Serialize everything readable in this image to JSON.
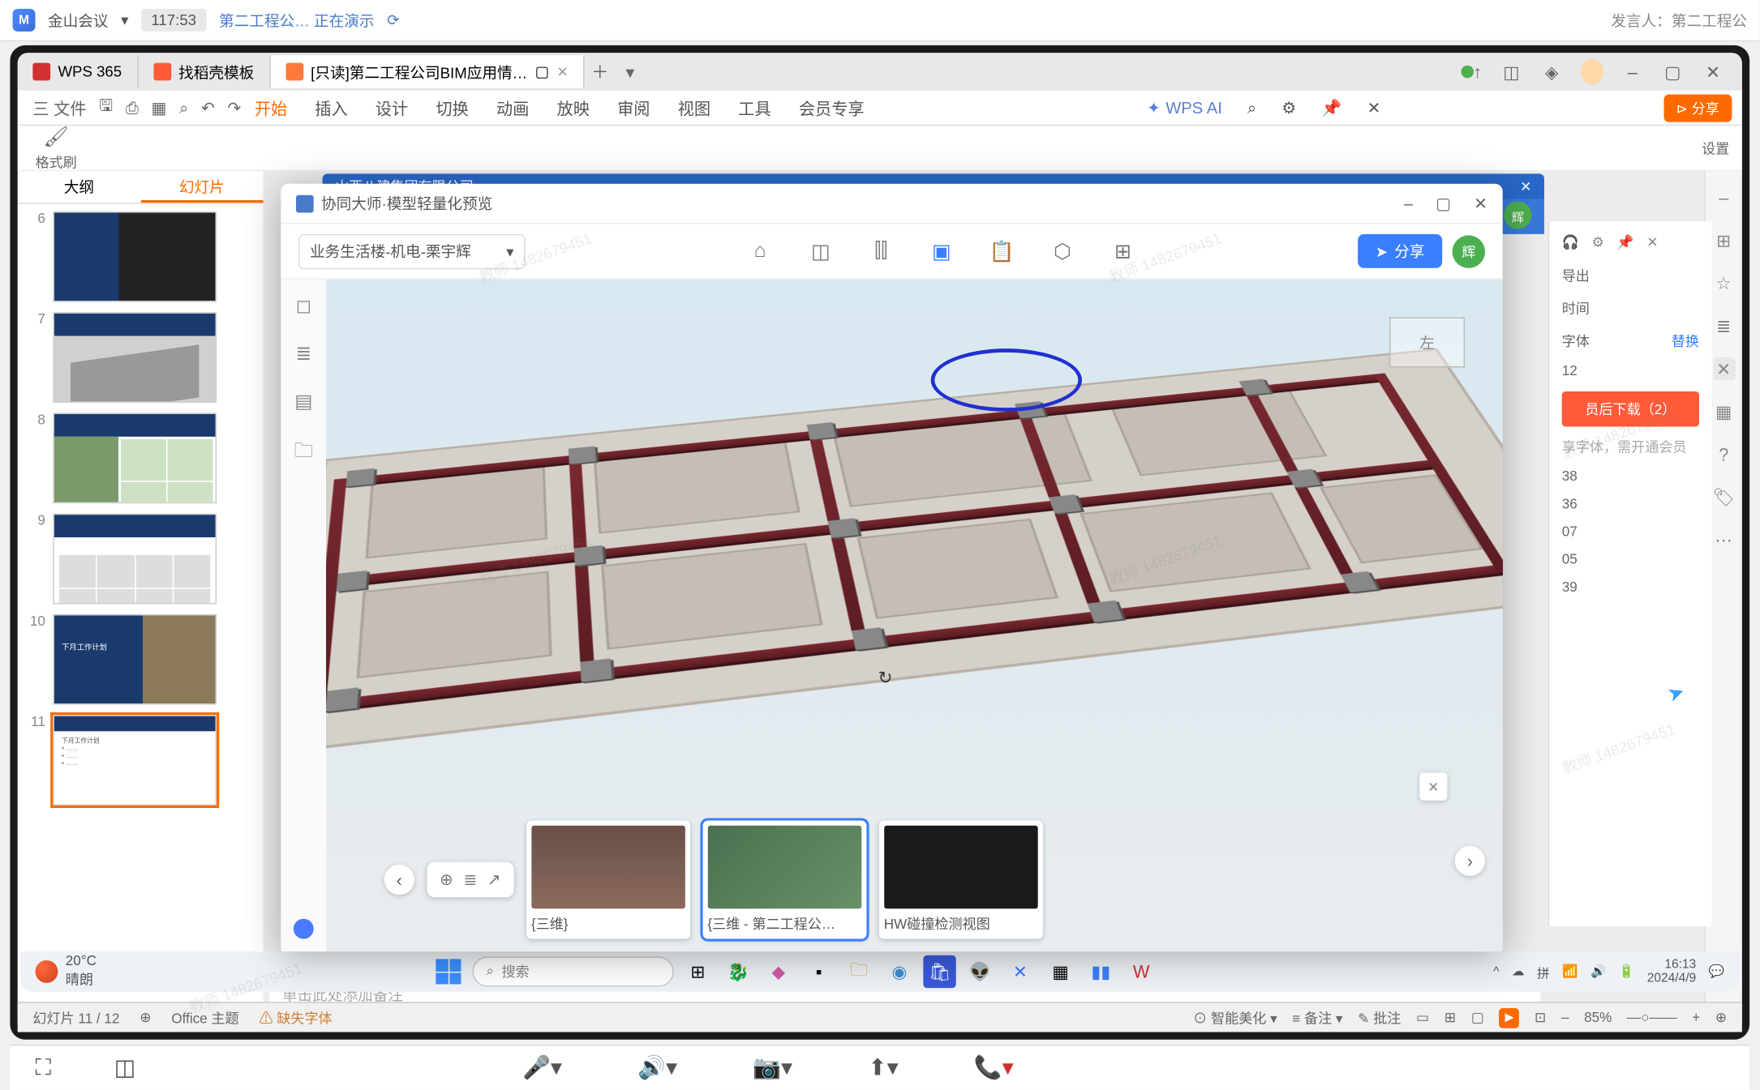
{
  "meeting": {
    "app": "金山会议",
    "time": "117:53",
    "presenting_label": "第二工程公… 正在演示",
    "host_label": "发言人：第二工程公"
  },
  "wps": {
    "tabs": [
      {
        "icon_color": "#d03030",
        "label": "WPS 365"
      },
      {
        "icon_color": "#ff5a3a",
        "label": "找稻壳模板"
      },
      {
        "icon_color": "#ff7a3a",
        "label": "[只读]第二工程公司BIM应用情…",
        "active": true,
        "has_close": true
      }
    ],
    "file_menu": "三 文件",
    "menus": [
      "开始",
      "插入",
      "设计",
      "切换",
      "动画",
      "放映",
      "审阅",
      "视图",
      "工具",
      "会员专享"
    ],
    "active_menu": "开始",
    "ai_label": "WPS AI",
    "share_label": "分享",
    "format_label": "格式刷",
    "settings_label": "设置",
    "slide_panel": {
      "outline_tab": "大纲",
      "slides_tab": "幻灯片",
      "add": "+",
      "slides": [
        {
          "n": "6"
        },
        {
          "n": "7"
        },
        {
          "n": "8"
        },
        {
          "n": "9"
        },
        {
          "n": "10"
        },
        {
          "n": "11",
          "selected": true
        }
      ]
    },
    "notes_placeholder": "单击此处添加备注",
    "status": {
      "slide_pos": "幻灯片 11 / 12",
      "theme": "Office 主题",
      "missing_font": "缺失字体",
      "beautify": "智能美化",
      "notes": "备注",
      "comments": "批注",
      "zoom": "85%"
    }
  },
  "blue_header": {
    "company": "山西八建集团有限公司"
  },
  "bim": {
    "title": "协同大师·模型轻量化预览",
    "dropdown": "业务生活楼-机电-栗宇辉",
    "share": "分享",
    "avatar_text": "辉",
    "nav_cube": "左",
    "thumbs": [
      {
        "name": "{三维}"
      },
      {
        "name": "{三维 - 第二工程公…",
        "selected": true
      },
      {
        "name": "HW碰撞检测视图"
      }
    ]
  },
  "design_panel": {
    "export": "导出",
    "time": "时间",
    "font": "字体",
    "replace": "替换",
    "num1": "38",
    "num2": "36",
    "num3": "07",
    "num4": "12",
    "num5": "05",
    "num6": "39",
    "download": "员后下载（2）",
    "font_hint": "享字体，需开通会员"
  },
  "taskbar": {
    "temp": "20°C",
    "weather": "晴朗",
    "search_placeholder": "搜索",
    "clock": "16:13",
    "date": "2024/4/9"
  },
  "watermark": "教师 1482679451"
}
